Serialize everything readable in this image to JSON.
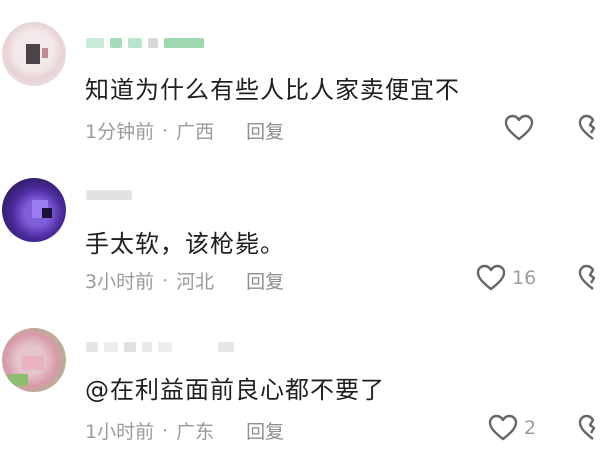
{
  "comments": [
    {
      "text": "知道为什么有些人比人家卖便宜不",
      "time": "1分钟前",
      "location": "广西",
      "reply_label": "回复",
      "like_count": ""
    },
    {
      "text": "手太软，该枪毙。",
      "time": "3小时前",
      "location": "河北",
      "reply_label": "回复",
      "like_count": "16"
    },
    {
      "text": "@在利益面前良心都不要了",
      "time": "1小时前",
      "location": "广东",
      "reply_label": "回复",
      "like_count": "2"
    }
  ],
  "separator": "·",
  "icons": {
    "like": "heart-outline-icon",
    "dislike": "heart-broken-outline-icon"
  },
  "colors": {
    "text": "#1f1f1f",
    "meta": "#9b9b9b",
    "icon": "#666666"
  }
}
